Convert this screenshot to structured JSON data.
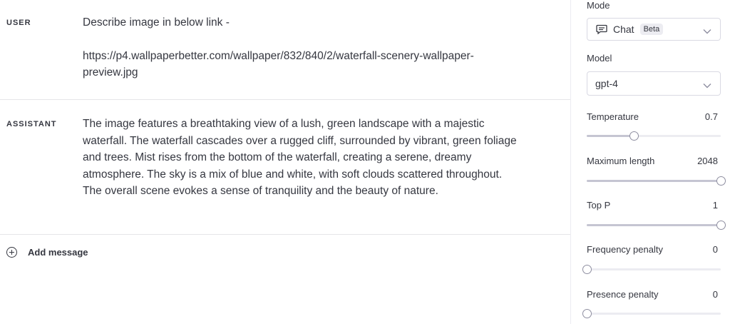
{
  "conversation": {
    "user": {
      "role": "USER",
      "line1": "Describe image in below link -",
      "line2": "https://p4.wallpaperbetter.com/wallpaper/832/840/2/waterfall-scenery-wallpaper-preview.jpg"
    },
    "assistant": {
      "role": "ASSISTANT",
      "text": "The image features a breathtaking view of a lush, green landscape with a majestic waterfall. The waterfall cascades over a rugged cliff, surrounded by vibrant, green foliage and trees. Mist rises from the bottom of the waterfall, creating a serene, dreamy atmosphere. The sky is a mix of blue and white, with soft clouds scattered throughout. The overall scene evokes a sense of tranquility and the beauty of nature."
    },
    "add_message_label": "Add message"
  },
  "settings": {
    "mode": {
      "label": "Mode",
      "value": "Chat",
      "badge": "Beta",
      "icon": "chat-bubble-icon"
    },
    "model": {
      "label": "Model",
      "value": "gpt-4"
    },
    "sliders": [
      {
        "label": "Temperature",
        "value": "0.7",
        "fraction": 0.35
      },
      {
        "label": "Maximum length",
        "value": "2048",
        "fraction": 1.0
      },
      {
        "label": "Top P",
        "value": "1",
        "fraction": 1.0
      },
      {
        "label": "Frequency penalty",
        "value": "0",
        "fraction": 0.0
      },
      {
        "label": "Presence penalty",
        "value": "0",
        "fraction": 0.0
      }
    ]
  },
  "colors": {
    "text": "#353740",
    "border": "#d9d9e3",
    "track": "#ececf1"
  }
}
